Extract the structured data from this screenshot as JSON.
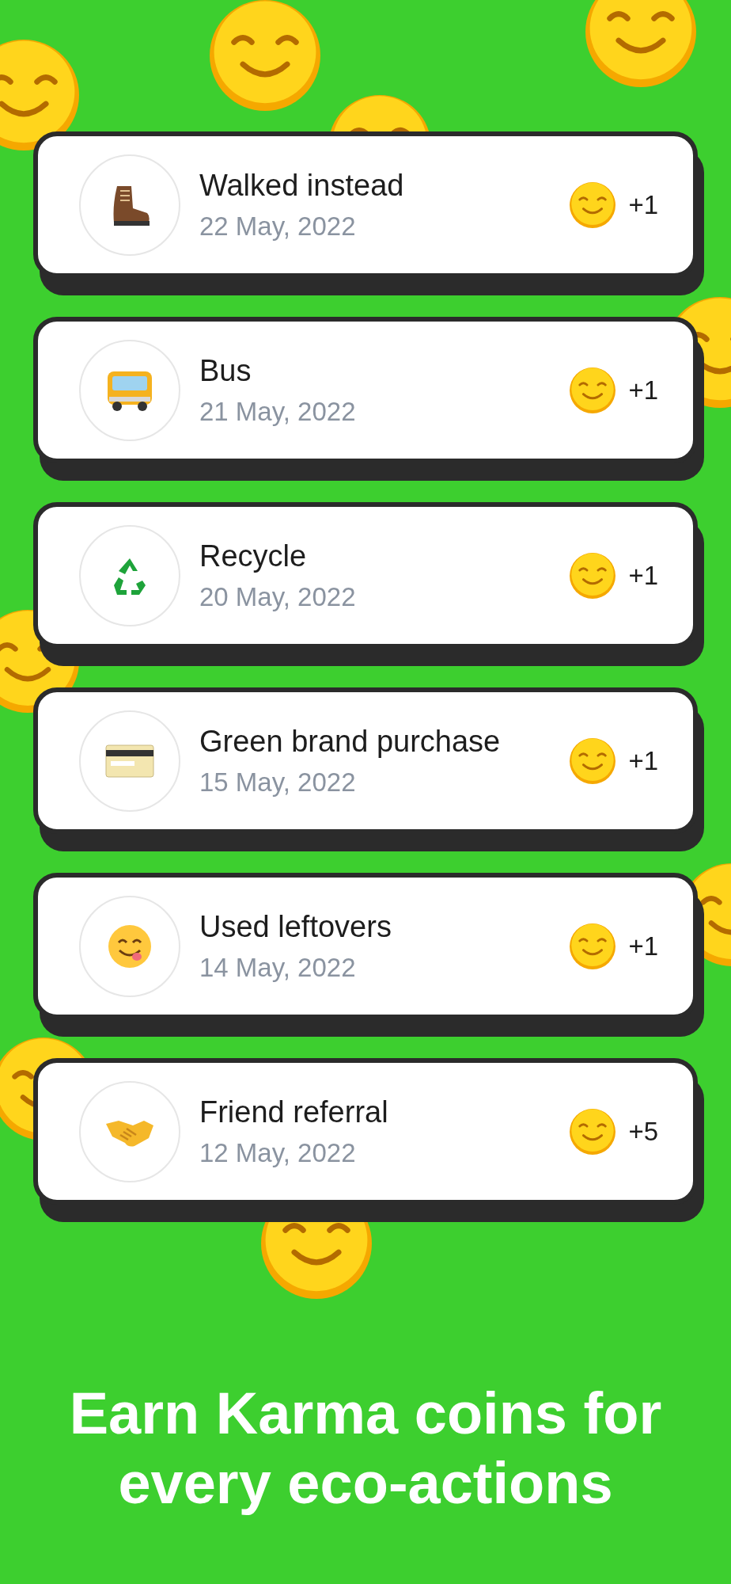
{
  "entries": [
    {
      "title": "Walked instead",
      "date": "22 May, 2022",
      "points": "+1"
    },
    {
      "title": "Bus",
      "date": "21 May, 2022",
      "points": "+1"
    },
    {
      "title": "Recycle",
      "date": "20 May, 2022",
      "points": "+1"
    },
    {
      "title": "Green brand purchase",
      "date": "15 May, 2022",
      "points": "+1"
    },
    {
      "title": "Used leftovers",
      "date": "14 May, 2022",
      "points": "+1"
    },
    {
      "title": "Friend referral",
      "date": "12 May, 2022",
      "points": "+5"
    }
  ],
  "headline": "Earn Karma coins for every eco-actions"
}
